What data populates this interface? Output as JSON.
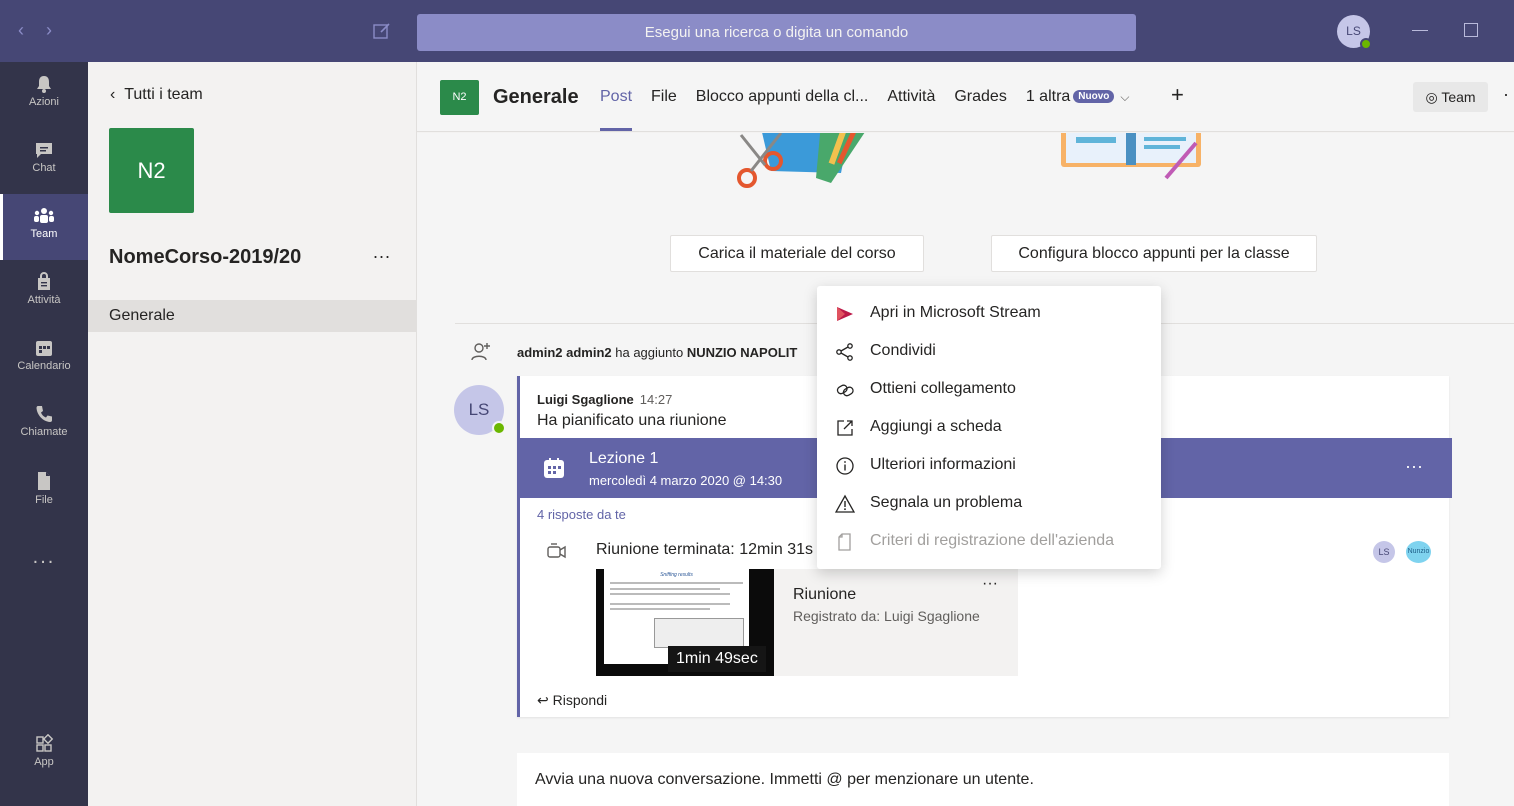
{
  "titlebar": {
    "search_placeholder": "Esegui una ricerca o digita un comando",
    "user_initials": "LS"
  },
  "rail": {
    "items": [
      {
        "label": "Azioni",
        "icon": "bell-icon"
      },
      {
        "label": "Chat",
        "icon": "chat-icon"
      },
      {
        "label": "Team",
        "icon": "team-icon",
        "active": true
      },
      {
        "label": "Attività",
        "icon": "assignments-icon"
      },
      {
        "label": "Calendario",
        "icon": "calendar-icon"
      },
      {
        "label": "Chiamate",
        "icon": "phone-icon"
      },
      {
        "label": "File",
        "icon": "file-icon"
      }
    ],
    "more": "...",
    "app_label": "App"
  },
  "team_panel": {
    "back_label": "Tutti i team",
    "team_initials": "N2",
    "team_name": "NomeCorso-2019/20",
    "more": "...",
    "channels": [
      "Generale"
    ]
  },
  "channel_header": {
    "initials": "N2",
    "name": "Generale",
    "tabs": [
      "Post",
      "File",
      "Blocco appunti della cl...",
      "Attività",
      "Grades",
      "1 altra"
    ],
    "new_badge": "Nuovo",
    "team_button": "Team"
  },
  "content": {
    "upload_button": "Carica il materiale del corso",
    "notebook_button": "Configura blocco appunti per la classe",
    "system_message_prefix": "admin2 admin2",
    "system_message_middle": " ha aggiunto ",
    "system_message_target": "NUNZIO NAPOLIT",
    "post": {
      "author_initials": "LS",
      "author": "Luigi Sgaglione",
      "time": "14:27",
      "text": "Ha pianificato una riunione",
      "meeting_title": "Lezione 1",
      "meeting_date": "mercoledì 4 marzo 2020 @ 14:30",
      "replies": "4 risposte da te",
      "ended_text": "Riunione terminata: 12min 31s",
      "participants": [
        "LS",
        "Nunzio"
      ],
      "recording": {
        "title": "Riunione",
        "recorded_by": "Registrato da: Luigi Sgaglione",
        "duration": "1min 49sec",
        "thumb_heading": "Sniffing results"
      },
      "reply": "Rispondi"
    },
    "new_conversation": "Avvia una nuova conversazione. Immetti @ per menzionare un utente."
  },
  "context_menu": {
    "items": [
      {
        "label": "Apri in Microsoft Stream",
        "icon": "stream-icon",
        "disabled": false
      },
      {
        "label": "Condividi",
        "icon": "share-icon",
        "disabled": false
      },
      {
        "label": "Ottieni collegamento",
        "icon": "link-icon",
        "disabled": false
      },
      {
        "label": "Aggiungi a scheda",
        "icon": "open-external-icon",
        "disabled": false
      },
      {
        "label": "Ulteriori informazioni",
        "icon": "info-icon",
        "disabled": false
      },
      {
        "label": "Segnala un problema",
        "icon": "warning-icon",
        "disabled": false
      },
      {
        "label": "Criteri di registrazione dell'azienda",
        "icon": "document-icon",
        "disabled": true
      }
    ]
  },
  "colors": {
    "titlebar": "#464775",
    "rail": "#33344a",
    "accent": "#6264a7",
    "team_tile": "#2b8a4a",
    "stream": "#bc1948"
  }
}
